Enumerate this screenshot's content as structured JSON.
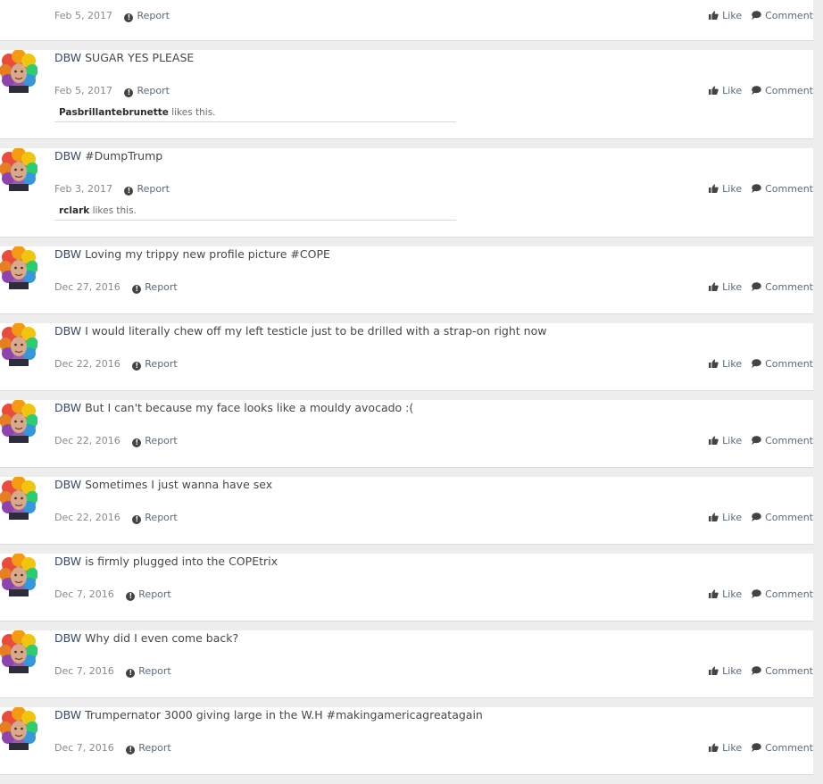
{
  "labels": {
    "report": "Report",
    "like": "Like",
    "comment": "Comment",
    "likes_suffix": "likes this."
  },
  "posts": [
    {
      "poster": "",
      "message": "",
      "date": "Feb 5, 2017",
      "liked_by": ""
    },
    {
      "poster": "DBW",
      "message": "SUGAR YES PLEASE",
      "date": "Feb 5, 2017",
      "liked_by": "Pasbrillantebrunette"
    },
    {
      "poster": "DBW",
      "message": "#DumpTrump",
      "date": "Feb 3, 2017",
      "liked_by": "rclark"
    },
    {
      "poster": "DBW",
      "message": "Loving my trippy new profile picture #COPE",
      "date": "Dec 27, 2016",
      "liked_by": ""
    },
    {
      "poster": "DBW",
      "message": "I would literally chew off my left testicle just to be drilled with a strap-on right now",
      "date": "Dec 22, 2016",
      "liked_by": ""
    },
    {
      "poster": "DBW",
      "message": "But I can't because my face looks like a mouldy avocado :(",
      "date": "Dec 22, 2016",
      "liked_by": ""
    },
    {
      "poster": "DBW",
      "message": "Sometimes I just wanna have sex",
      "date": "Dec 22, 2016",
      "liked_by": ""
    },
    {
      "poster": "DBW",
      "message": "is firmly plugged into the COPEtrix",
      "date": "Dec 7, 2016",
      "liked_by": ""
    },
    {
      "poster": "DBW",
      "message": "Why did I even come back?",
      "date": "Dec 7, 2016",
      "liked_by": ""
    },
    {
      "poster": "DBW",
      "message": "Trumpernator 3000 giving large in the W.H #makingamericagreatagain",
      "date": "Dec 7, 2016",
      "liked_by": ""
    }
  ]
}
